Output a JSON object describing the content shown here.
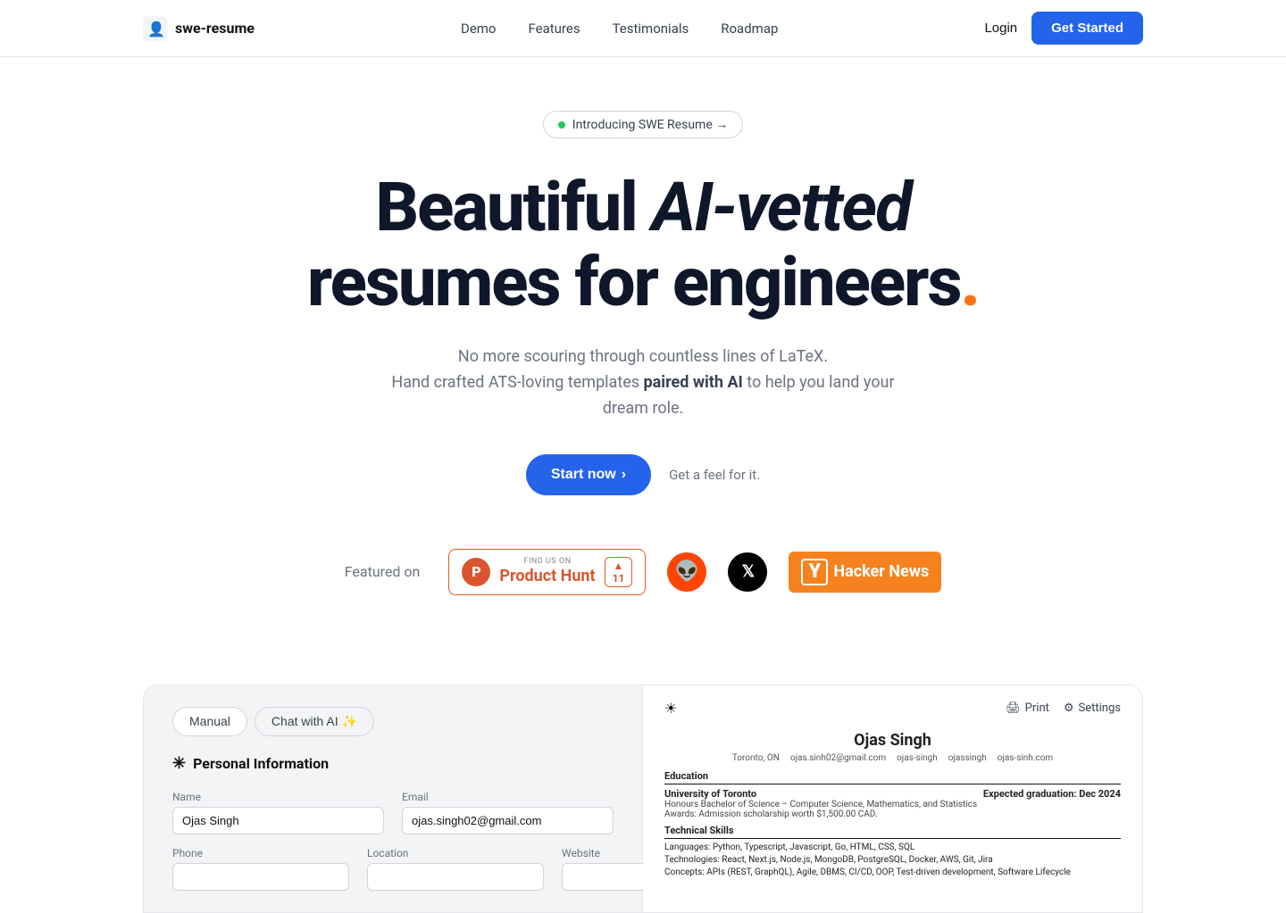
{
  "nav": {
    "logo_text": "swe-resume",
    "links": [
      "Demo",
      "Features",
      "Testimonials",
      "Roadmap"
    ],
    "login_label": "Login",
    "get_started_label": "Get Started"
  },
  "hero": {
    "announcement": "Introducing SWE Resume →",
    "heading_part1": "Beautiful ",
    "heading_italic": "AI-vetted",
    "heading_part2": " resumes for engineers",
    "heading_dot": ".",
    "subtext_line1": "No more scouring through countless lines of LaTeX.",
    "subtext_line2_start": "Hand crafted ATS-loving templates ",
    "subtext_bold": "paired with AI",
    "subtext_line2_end": " to help you land your dream role.",
    "cta_primary": "Start now",
    "cta_secondary": "Get a feel for it."
  },
  "featured": {
    "label": "Featured on",
    "product_hunt": {
      "find_label": "FIND US ON",
      "name": "Product Hunt",
      "upvote_count": "11"
    },
    "hacker_news": "Hacker News"
  },
  "demo": {
    "tab_manual": "Manual",
    "tab_ai": "Chat with AI ✨",
    "section_title": "Personal Information",
    "fields": {
      "name_label": "Name",
      "name_value": "Ojas Singh",
      "email_label": "Email",
      "email_value": "ojas.singh02@gmail.com",
      "phone_label": "Phone",
      "location_label": "Location",
      "website_label": "Website"
    },
    "print_label": "Print",
    "settings_label": "Settings"
  },
  "resume": {
    "name": "Ojas Singh",
    "contact": {
      "location": "Toronto, ON",
      "email": "ojas.sinh02@gmail.com",
      "github": "ojas-singh",
      "linkedin": "ojassingh",
      "website": "ojas-sinh.com"
    },
    "education_title": "Education",
    "university": "University of Toronto",
    "graduation": "Expected graduation: Dec 2024",
    "degree": "Honours Bachelor of Science – Computer Science, Mathematics, and Statistics",
    "awards": "Awards: Admission scholarship worth $1,500.00 CAD.",
    "skills_title": "Technical Skills",
    "languages": "Languages: Python, Typescript, Javascript, Go, HTML, CSS, SQL",
    "technologies": "Technologies: React, Next.js, Node.js, MongoDB, PostgreSQL, Docker, AWS, Git, Jira",
    "concepts": "Concepts: APIs (REST, GraphQL), Agile, DBMS, CI/CD, OOP, Test-driven development, Software Lifecycle"
  }
}
